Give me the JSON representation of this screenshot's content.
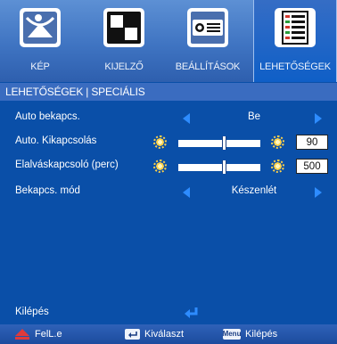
{
  "tabs": [
    {
      "label": "KÉP",
      "icon": "picture-icon",
      "active": false
    },
    {
      "label": "KIJELZŐ",
      "icon": "display-icon",
      "active": false
    },
    {
      "label": "BEÁLLÍTÁSOK",
      "icon": "projector-icon",
      "active": false
    },
    {
      "label": "LEHETŐSÉGEK",
      "icon": "options-list-icon",
      "active": true
    }
  ],
  "breadcrumb": "LEHETŐSÉGEK | SPECIÁLIS",
  "rows": {
    "auto_power_on": {
      "label": "Auto bekapcs.",
      "value": "Be"
    },
    "auto_power_off": {
      "label": "Auto. Kikapcsolás",
      "value": "90",
      "level": 0.55
    },
    "sleep_timer": {
      "label": "Elalváskapcsoló (perc)",
      "value": "500",
      "level": 0.55
    },
    "power_mode": {
      "label": "Bekapcs. mód",
      "value": "Készenlét"
    }
  },
  "exit": {
    "label": "Kilépés"
  },
  "footer": {
    "exit": {
      "label": "FelL.e",
      "icon": "up-arrow-icon"
    },
    "select": {
      "label": "Kiválaszt",
      "icon": "enter-key-icon"
    },
    "quit": {
      "icon_text": "Menu",
      "label": "Kilépés",
      "icon": "menu-key-icon"
    }
  },
  "colors": {
    "background": "#0a4fa8",
    "accent": "#2e8cff",
    "footer_arrow": "#e03a3a"
  }
}
